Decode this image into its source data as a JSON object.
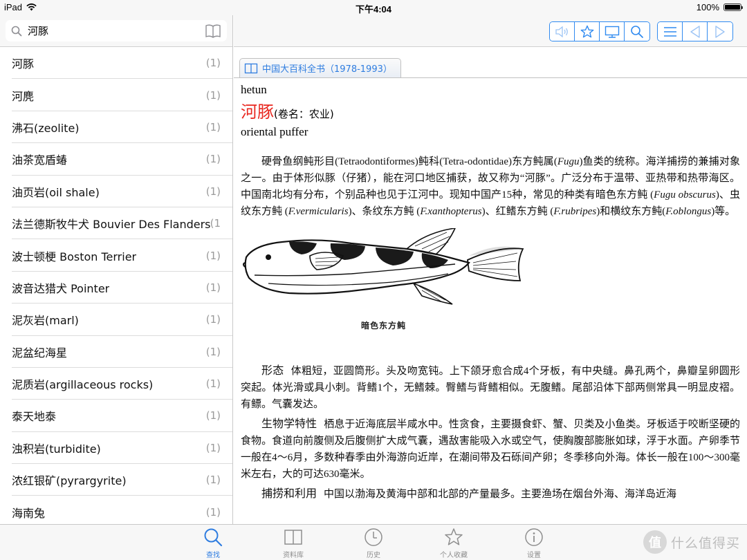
{
  "status_bar": {
    "device": "iPad",
    "time": "下午4:04",
    "battery": "100%",
    "battery_level": 1.0
  },
  "search": {
    "query": "河豚",
    "placeholder": ""
  },
  "results": [
    {
      "label": "河豚",
      "count": "(1)"
    },
    {
      "label": "河麂",
      "count": "(1)"
    },
    {
      "label": "沸石(zeolite)",
      "count": "(1)"
    },
    {
      "label": "油茶宽盾蝽",
      "count": "(1)"
    },
    {
      "label": "油页岩(oil shale)",
      "count": "(1)"
    },
    {
      "label": "法兰德斯牧牛犬 Bouvier Des Flanders",
      "count": "(1"
    },
    {
      "label": "波士顿梗 Boston Terrier",
      "count": "(1)"
    },
    {
      "label": "波音达猎犬 Pointer",
      "count": "(1)"
    },
    {
      "label": "泥灰岩(marl)",
      "count": "(1)"
    },
    {
      "label": "泥盆纪海星",
      "count": "(1)"
    },
    {
      "label": "泥质岩(argillaceous rocks)",
      "count": "(1)"
    },
    {
      "label": "泰天地泰",
      "count": "(1)"
    },
    {
      "label": "浊积岩(turbidite)",
      "count": "(1)"
    },
    {
      "label": "浓红银矿(pyrargyrite)",
      "count": "(1)"
    },
    {
      "label": "海南兔",
      "count": "(1)"
    }
  ],
  "toolbar": {
    "buttons_group1": [
      "speaker-icon",
      "star-icon",
      "monitor-icon",
      "search-icon"
    ],
    "buttons_group2": [
      "list-icon",
      "prev-icon",
      "next-icon"
    ],
    "accent": "#2f8af0"
  },
  "source_tab": {
    "label": "中国大百科全书（1978-1993）"
  },
  "article": {
    "pinyin": "hetun",
    "headword": "河豚",
    "volume": "(卷名：农业)",
    "english": "oriental puffer",
    "intro": [
      {
        "t": "硬骨鱼纲鲀形目(Tetraodontiformes)鲀科(Tetra-odontidae)东方鲀属("
      },
      {
        "t": "Fugu",
        "i": true
      },
      {
        "t": ")鱼类的统称。海洋捕捞的兼捕对象之一。由于体形似豚（仔猪），能在河口地区捕获，故又称为“河豚”。广泛分布于温带、亚热带和热带海区。中国南北均有分布，个别品种也见于江河中。现知中国产15种，常见的种类有暗色东方鲀 ("
      },
      {
        "t": "Fugu obscurus",
        "i": true
      },
      {
        "t": ")、虫纹东方鲀 ("
      },
      {
        "t": "F.vermicularis",
        "i": true
      },
      {
        "t": ")、条纹东方鲀 ("
      },
      {
        "t": "F.xanthopterus",
        "i": true
      },
      {
        "t": ")、红鳍东方鲀 ("
      },
      {
        "t": "F.rubripes",
        "i": true
      },
      {
        "t": ")和横纹东方鲀("
      },
      {
        "t": "F.oblongus",
        "i": true
      },
      {
        "t": ")等。"
      }
    ],
    "figure_caption": "暗色东方鲀",
    "sections": [
      {
        "title": "形态",
        "text": "体粗短，亚圆筒形。头及吻宽钝。上下颌牙愈合成4个牙板，有中央缝。鼻孔两个，鼻瓣呈卵圆形突起。体光滑或具小刺。背鳍1个，无鳍棘。臀鳍与背鳍相似。无腹鳍。尾部沿体下部两侧常具一明显皮褶。有鳔。气囊发达。"
      },
      {
        "title": "生物学特性",
        "text": "栖息于近海底层半咸水中。性贪食，主要摄食虾、蟹、贝类及小鱼类。牙板适于咬断坚硬的食物。食道向前腹侧及后腹侧扩大成气囊，遇敌害能吸入水或空气，使胸腹部膨胀如球，浮于水面。产卵季节一般在4～6月，多数种春季由外海游向近岸，在潮间带及石砾间产卵；冬季移向外海。体长一般在100～300毫米左右，大的可达630毫米。"
      },
      {
        "title": "捕捞和利用",
        "text": "中国以渤海及黄海中部和北部的产量最多。主要渔场在烟台外海、海洋岛近海"
      }
    ]
  },
  "tabbar": {
    "items": [
      {
        "label": "查找",
        "icon": "search-icon",
        "active": true
      },
      {
        "label": "资料库",
        "icon": "book-icon",
        "active": false
      },
      {
        "label": "历史",
        "icon": "clock-icon",
        "active": false
      },
      {
        "label": "个人收藏",
        "icon": "star-icon",
        "active": false
      },
      {
        "label": "设置",
        "icon": "info-icon",
        "active": false
      }
    ],
    "watermark": "什么值得买",
    "watermark_logo": "值"
  }
}
